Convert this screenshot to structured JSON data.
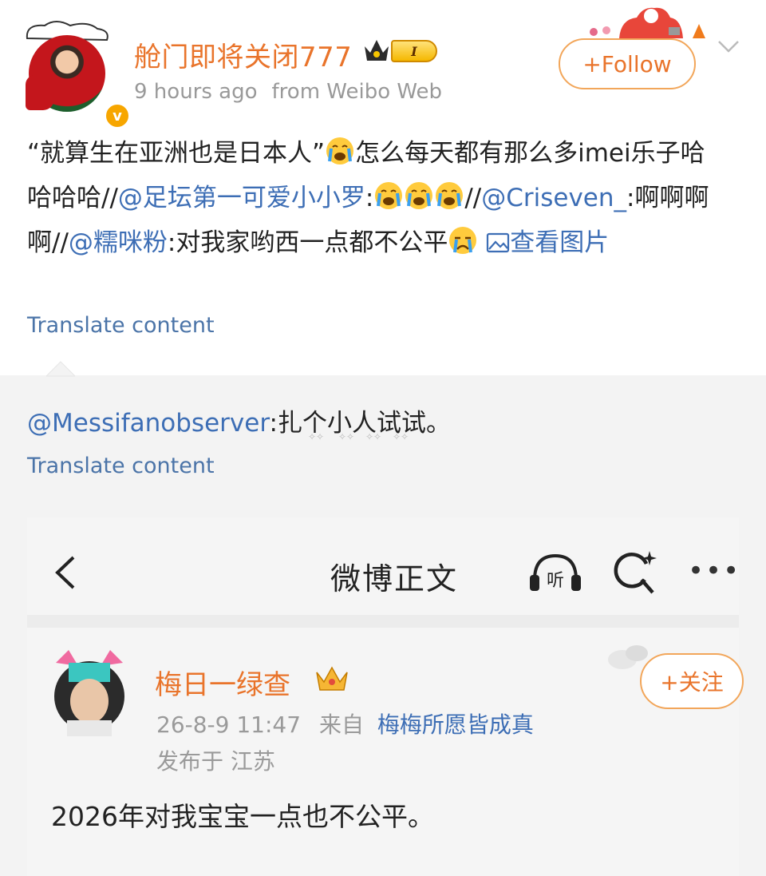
{
  "post": {
    "username": "舱门即将关闭777",
    "level_badge": "I",
    "time": "9 hours ago",
    "source": "from Weibo Web",
    "follow_label": "+Follow",
    "text": {
      "seg1": "“就算生在亚洲也是日本人”",
      "seg2": "怎么每天都有那么多imei乐子哈哈哈哈//",
      "mention1": "@足坛第一可爱小小罗",
      "seg3": ":",
      "seg4": "//",
      "mention2": "@Criseven_",
      "seg5": ":啊啊啊啊//",
      "mention3": "@糯咪粉",
      "seg6": ":对我家哟西一点都不公平",
      "view_image": "查看图片"
    },
    "translate": "Translate content"
  },
  "repost": {
    "mention": "@Messifanobserver",
    "text": ":扎个小人试试。",
    "translate": "Translate content"
  },
  "embedded": {
    "bar_title": "微博正文",
    "listen_label": "听",
    "username": "梅日一绿查",
    "time": "26-8-9 11:47",
    "from_prefix": "来自",
    "from_name": "梅梅所愿皆成真",
    "location": "发布于 江苏",
    "follow_label": "+关注",
    "content": "2026年对我宝宝一点也不公平。"
  },
  "colors": {
    "accent_orange": "#e9742b",
    "link_blue": "#3d6eb5",
    "meta_gray": "#999999"
  }
}
